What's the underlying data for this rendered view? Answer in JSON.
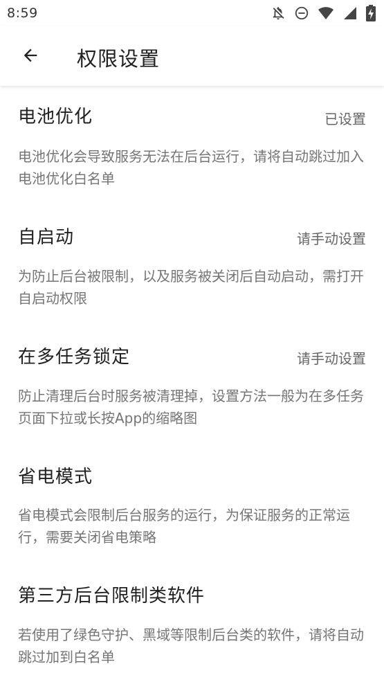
{
  "status_bar": {
    "time": "8:59",
    "icons": [
      "notifications-off-icon",
      "do-not-disturb-icon",
      "wifi-icon",
      "signal-icon",
      "battery-charging-icon"
    ]
  },
  "app_bar": {
    "back_icon": "arrow-back-icon",
    "title": "权限设置"
  },
  "settings": [
    {
      "title": "电池优化",
      "status": "已设置",
      "description": "电池优化会导致服务无法在后台运行，请将自动跳过加入电池优化白名单"
    },
    {
      "title": "自启动",
      "status": "请手动设置",
      "description": "为防止后台被限制，以及服务被关闭后自动启动，需打开自启动权限"
    },
    {
      "title": "在多任务锁定",
      "status": "请手动设置",
      "description": "防止清理后台时服务被清理掉，设置方法一般为在多任务页面下拉或长按App的缩略图"
    },
    {
      "title": "省电模式",
      "status": "",
      "description": "省电模式会限制后台服务的运行，为保证服务的正常运行，需要关闭省电策略"
    },
    {
      "title": "第三方后台限制类软件",
      "status": "",
      "description": "若使用了绿色守护、黑域等限制后台类的软件，请将自动跳过加到白名单"
    }
  ]
}
